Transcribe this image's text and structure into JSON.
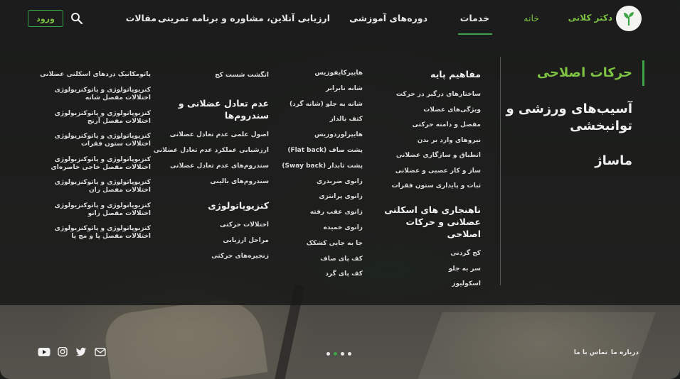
{
  "header": {
    "brand": "دکتر کلانی",
    "nav": {
      "home": "خانه",
      "services": "خدمات",
      "courses": "دوره‌های آموزشی",
      "evaluation": "ارزیابی آنلاین، مشاوره و برنامه تمرینی",
      "articles": "مقالات"
    },
    "login": "ورود",
    "icons": {
      "search": "search-icon",
      "logo": "logo-plant-icon"
    },
    "accent": "#3fa447"
  },
  "side_menu": {
    "active": "حرکات اصلاحی",
    "item2": "آسیب‌های ورزشی و توانبخشی",
    "item3": "ماساژ"
  },
  "columns": {
    "col1": {
      "heading1": "مفاهیم پایه",
      "items1": [
        "ساختارهای درگیر در حرکت",
        "ویژگی‌های عضلات",
        "مفصل و دامنه حرکتی",
        "نیروهای وارد بر بدن",
        "انطباق و سازگاری عضلانی",
        "ساز و کار عصبی و عضلانی",
        "ثبات و پایداری ستون فقرات"
      ],
      "heading2": "ناهنجاری های اسکلتی عضلانی و حرکات اصلاحی",
      "items2": [
        "کج گردنی",
        "سر به جلو",
        "اسکولیوز"
      ]
    },
    "col2": {
      "items": [
        "هایپرکایفوزیس",
        "شانه نابرابر",
        "شانه به جلو (شانه گرد)",
        "کتف بالدار",
        "هایپرلوردوزیس",
        "پشت صاف (Flat back)",
        "پشت تابدار (Sway back)",
        "زانوی ضربدری",
        "زانوی پرانتزی",
        "زانوی عقب رفته",
        "زانوی خمیده",
        "جا به جایی کشکک",
        "کف پای صاف",
        "کف پای گرد"
      ]
    },
    "col3": {
      "item_top": "انگشت شست کج",
      "heading1": "عدم تعادل عضلانی و سندروم‌ها",
      "items1": [
        "اصول علمی عدم تعادل عضلانی",
        "ارزشیابی عملکرد عدم تعادل عضلانی",
        "سندروم‌های عدم تعادل عضلانی",
        "سندروم‌های بالینی"
      ],
      "heading2": "کنزیوپاتولوژی",
      "items2": [
        "اختلالات حرکتی",
        "مراحل ارزیابی",
        "زنجیره‌های حرکتی"
      ]
    },
    "col4": {
      "items": [
        "پاتومکانیک دردهای اسکلتی عضلانی",
        "کنزیوپاتولوژی و پاتوکنزیولوژی اختلالات مفصل شانه",
        "کنزیوپاتولوژی و پاتوکنزیولوژی اختلالات مفصل آرنج",
        "کنزیوپاتولوژی و پاتوکنزیولوژی اختلالات ستون فقرات",
        "کنزیوپاتولوژی و پاتوکنزیولوژی اختلالات مفصل خاجی خاصره‌ای",
        "کنزیوپاتولوژی و پاتوکنزیولوژی اختلالات مفصل ران",
        "کنزیوپاتولوژی و پاتوکنزیولوژی اختلالات مفصل زانو",
        "کنزیوپاتولوژی و پاتوکنزیولوژی اختلالات مفصل پا و مچ پا"
      ]
    }
  },
  "footer": {
    "about": "درباره ما",
    "contact": "تماس با ما",
    "slider_dots": 4,
    "active_dot": 2,
    "social_icons": [
      "email-icon",
      "twitter-icon",
      "instagram-icon",
      "youtube-icon"
    ]
  }
}
